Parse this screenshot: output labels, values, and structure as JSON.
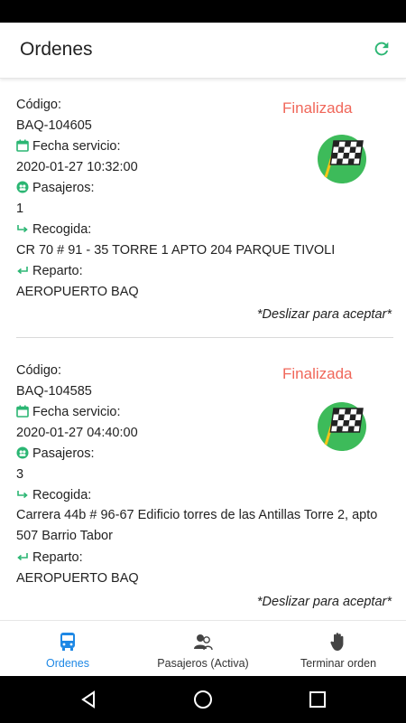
{
  "header": {
    "title": "Ordenes"
  },
  "labels": {
    "codigo": "Código:",
    "fecha": "Fecha servicio:",
    "pasajeros": "Pasajeros:",
    "recogida": "Recogida:",
    "reparto": "Reparto:"
  },
  "orders": [
    {
      "codigo": "BAQ-104605",
      "status": "Finalizada",
      "fecha": "2020-01-27 10:32:00",
      "pasajeros": "1",
      "recogida": "CR 70 # 91 - 35 TORRE 1 APTO 204 PARQUE TIVOLI",
      "reparto": "AEROPUERTO BAQ",
      "hint": "*Deslizar para aceptar*"
    },
    {
      "codigo": "BAQ-104585",
      "status": "Finalizada",
      "fecha": "2020-01-27 04:40:00",
      "pasajeros": "3",
      "recogida": "Carrera 44b # 96-67 Edificio torres de las Antillas Torre 2, apto 507 Barrio Tabor",
      "reparto": "AEROPUERTO BAQ",
      "hint": "*Deslizar para aceptar*"
    }
  ],
  "bottom_nav": [
    {
      "label": "Ordenes",
      "icon": "bus-icon",
      "active": true
    },
    {
      "label": "Pasajeros (Activa)",
      "icon": "people-icon",
      "active": false
    },
    {
      "label": "Terminar orden",
      "icon": "hand-icon",
      "active": false
    }
  ],
  "colors": {
    "accent": "#2bb673",
    "status": "#f0675a",
    "nav_active": "#1e88e5",
    "flag_bg": "#3dbb5a"
  }
}
